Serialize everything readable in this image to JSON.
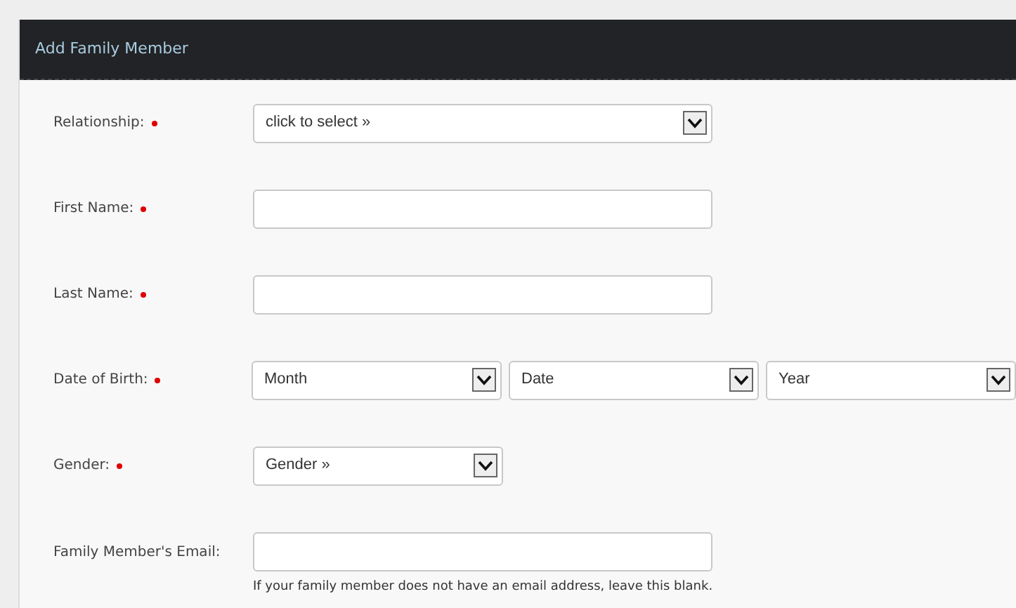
{
  "panel": {
    "title": "Add Family Member"
  },
  "rows": [
    {
      "label": "Relationship:",
      "required": true,
      "controls": [
        {
          "kind": "select",
          "value": "click to select »"
        }
      ]
    },
    {
      "label": "First Name:",
      "required": true,
      "controls": [
        {
          "kind": "text"
        }
      ]
    },
    {
      "label": "Last Name:",
      "required": true,
      "controls": [
        {
          "kind": "text"
        }
      ]
    },
    {
      "label": "Date of Birth:",
      "required": true,
      "controls": [
        {
          "kind": "short-select",
          "value": "Month"
        },
        {
          "kind": "short-select",
          "value": "Date"
        },
        {
          "kind": "short-select",
          "value": "Year"
        }
      ]
    },
    {
      "label": "Gender:",
      "required": true,
      "controls": [
        {
          "kind": "short-select",
          "value": "Gender »"
        }
      ]
    },
    {
      "label": "Family Member's Email:",
      "required": false,
      "controls": [
        {
          "kind": "text"
        }
      ],
      "hint": "If your family member does not have an email address, leave this blank."
    }
  ]
}
